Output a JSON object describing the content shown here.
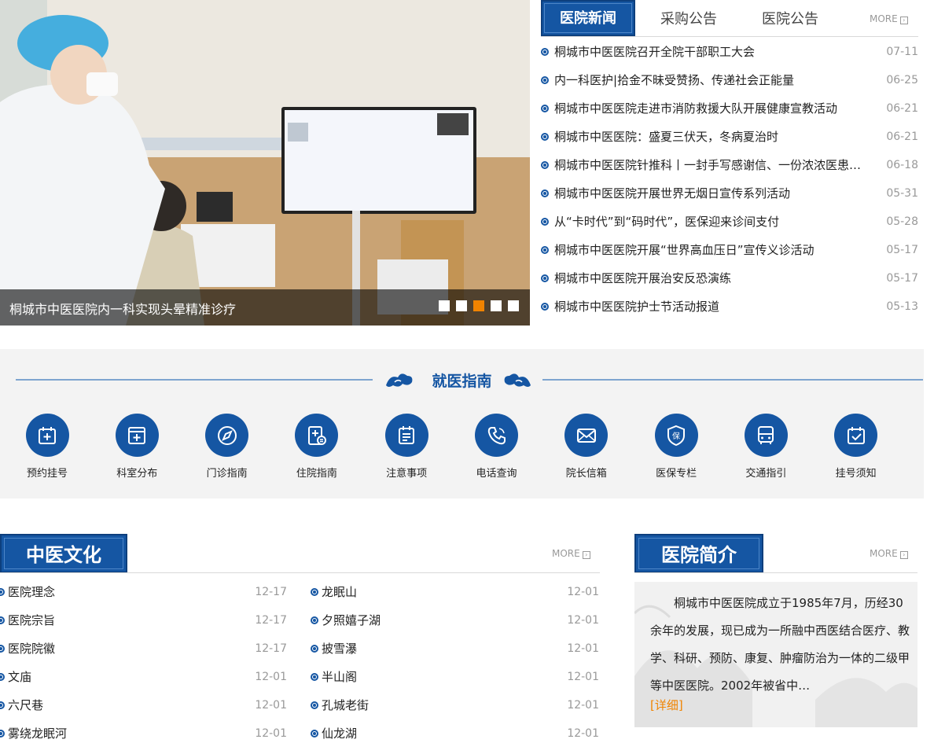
{
  "hero": {
    "caption": "桐城市中医医院内一科实现头晕精准诊疗",
    "slide_count": 5,
    "active_slide": 3
  },
  "news": {
    "tabs": [
      "医院新闻",
      "采购公告",
      "医院公告"
    ],
    "more": "MORE",
    "items": [
      {
        "title": "桐城市中医医院召开全院干部职工大会",
        "date": "07-11"
      },
      {
        "title": "内一科医护|拾金不昧受赞扬、传递社会正能量",
        "date": "06-25"
      },
      {
        "title": "桐城市中医医院走进市消防救援大队开展健康宣教活动",
        "date": "06-21"
      },
      {
        "title": "桐城市中医医院：盛夏三伏天，冬病夏治时",
        "date": "06-21"
      },
      {
        "title": "桐城市中医医院针推科丨一封手写感谢信、一份浓浓医患…",
        "date": "06-18"
      },
      {
        "title": "桐城市中医医院开展世界无烟日宣传系列活动",
        "date": "05-31"
      },
      {
        "title": "从“卡时代”到“码时代”，医保迎来诊间支付",
        "date": "05-28"
      },
      {
        "title": "桐城市中医医院开展“世界高血压日”宣传义诊活动",
        "date": "05-17"
      },
      {
        "title": "桐城市中医医院开展治安反恐演练",
        "date": "05-17"
      },
      {
        "title": "桐城市中医医院护士节活动报道",
        "date": "05-13"
      }
    ]
  },
  "guide": {
    "title": "就医指南",
    "items": [
      {
        "label": "预约挂号",
        "icon": "calendar-plus-icon"
      },
      {
        "label": "科室分布",
        "icon": "medical-kit-icon"
      },
      {
        "label": "门诊指南",
        "icon": "compass-icon"
      },
      {
        "label": "住院指南",
        "icon": "inpatient-doc-icon"
      },
      {
        "label": "注意事项",
        "icon": "notice-list-icon"
      },
      {
        "label": "电话查询",
        "icon": "phone-icon"
      },
      {
        "label": "院长信箱",
        "icon": "mail-icon"
      },
      {
        "label": "医保专栏",
        "icon": "insurance-shield-icon"
      },
      {
        "label": "交通指引",
        "icon": "bus-icon"
      },
      {
        "label": "挂号须知",
        "icon": "calendar-check-icon"
      }
    ]
  },
  "culture": {
    "title": "中医文化",
    "more": "MORE",
    "left": [
      {
        "title": "医院理念",
        "date": "12-17"
      },
      {
        "title": "医院宗旨",
        "date": "12-17"
      },
      {
        "title": "医院院徽",
        "date": "12-17"
      },
      {
        "title": "文庙",
        "date": "12-01"
      },
      {
        "title": "六尺巷",
        "date": "12-01"
      },
      {
        "title": "雾绕龙眠河",
        "date": "12-01"
      }
    ],
    "right": [
      {
        "title": "龙眠山",
        "date": "12-01"
      },
      {
        "title": "夕照嬉子湖",
        "date": "12-01"
      },
      {
        "title": "披雪瀑",
        "date": "12-01"
      },
      {
        "title": "半山阁",
        "date": "12-01"
      },
      {
        "title": "孔城老街",
        "date": "12-01"
      },
      {
        "title": "仙龙湖",
        "date": "12-01"
      }
    ]
  },
  "intro": {
    "title": "医院简介",
    "more": "MORE",
    "text": "桐城市中医医院成立于1985年7月，历经30余年的发展，现已成为一所融中西医结合医疗、教学、科研、预防、康复、肿瘤防治为一体的二级甲等中医医院。2002年被省中…",
    "detail": "[详细]"
  },
  "colors": {
    "primary": "#1556a3",
    "accent": "#f08300"
  }
}
